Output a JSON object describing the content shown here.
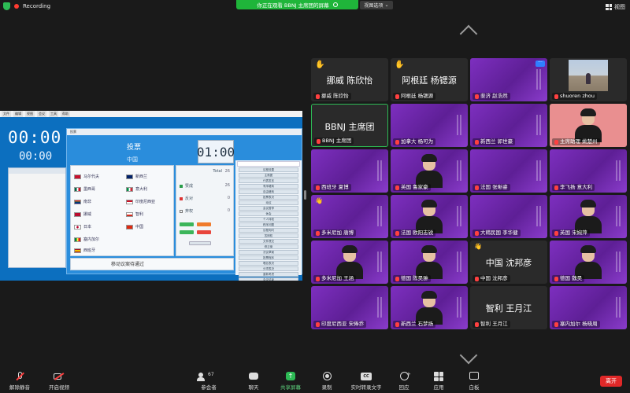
{
  "top": {
    "recording": "Recording",
    "viewing_banner": "你正在观看 BBNJ 主席团的屏幕",
    "view_options": "视图选项",
    "view_label": "视图"
  },
  "share": {
    "menu": [
      "文件",
      "编辑",
      "视图",
      "会议",
      "工具",
      "帮助"
    ],
    "clock_main": "00:00",
    "clock_sub": "00:00",
    "window_caption": "投票",
    "vote_title": "投票",
    "vote_country": "中国",
    "timer": "01:00",
    "total_label": "Total",
    "total_value": "26",
    "yes_label": "赞成",
    "yes_value": "26",
    "no_label": "反对",
    "no_value": "0",
    "abstain_label": "弃权",
    "abstain_value": "0",
    "countries": [
      "马尔代夫",
      "墨西哥",
      "南非",
      "挪威",
      "日本",
      "塞内加尔",
      "西班牙",
      "新西兰",
      "意大利",
      "印度尼西亚",
      "智利",
      "中国"
    ],
    "bottom_note": "移动议案待通过",
    "right_items": [
      "议程设置",
      "主席团",
      "代表发言",
      "有序磋商",
      "自由磋商",
      "投票表决",
      "动议",
      "会议暂停",
      "休会",
      "个人特权",
      "秩序问题",
      "议程询问",
      "答辩权",
      "文件提交",
      "修正案",
      "决议草案",
      "投票程序",
      "唱名表决",
      "分项表决",
      "重新考虑",
      "会议结束"
    ]
  },
  "tiles": [
    {
      "big": "挪威 陈欣怡",
      "label": "挪威 陈欣怡",
      "hand": true
    },
    {
      "big": "阿根廷 杨锶源",
      "label": "阿根廷 杨锶源",
      "hand": true
    },
    {
      "label": "斐济 赵浩然"
    },
    {
      "label": "shuoren zhou"
    },
    {
      "big": "BBNJ 主席团",
      "label": "BBNJ 主席团"
    },
    {
      "label": "加拿大 杨可为"
    },
    {
      "label": "新西兰 郭世豪"
    },
    {
      "label": "主席助理 姚楚州"
    },
    {
      "label": "西班牙 夏博"
    },
    {
      "label": "英国 鲁家豪"
    },
    {
      "label": "法国 张晰睿"
    },
    {
      "label": "李飞扬 意大利"
    },
    {
      "label": "多米尼加 唐博"
    },
    {
      "label": "法国 欧阳志锐"
    },
    {
      "label": "大韩民国 李华健"
    },
    {
      "label": "英国 宋婉萍"
    },
    {
      "label": "多米尼加 王涵"
    },
    {
      "label": "德国 陈昊翀"
    },
    {
      "big": "中国 沈邦彦",
      "label": "中国 沈邦彦"
    },
    {
      "label": "德国 魏昊"
    },
    {
      "label": "印度尼西亚 宋俸乔"
    },
    {
      "label": "新西兰 石梦扬"
    },
    {
      "big": "智利 王月江",
      "label": "智利 王月江"
    },
    {
      "label": "塞内加尔 杨晓周"
    }
  ],
  "toolbar": {
    "unmute": "解除静音",
    "start_video": "开启视频",
    "participants": "参会者",
    "participants_count": "67",
    "chat": "聊天",
    "share_screen": "共享屏幕",
    "record": "录制",
    "captions": "实时转录文字",
    "reactions": "回应",
    "apps": "应用",
    "whiteboard": "白板",
    "leave": "离开"
  }
}
